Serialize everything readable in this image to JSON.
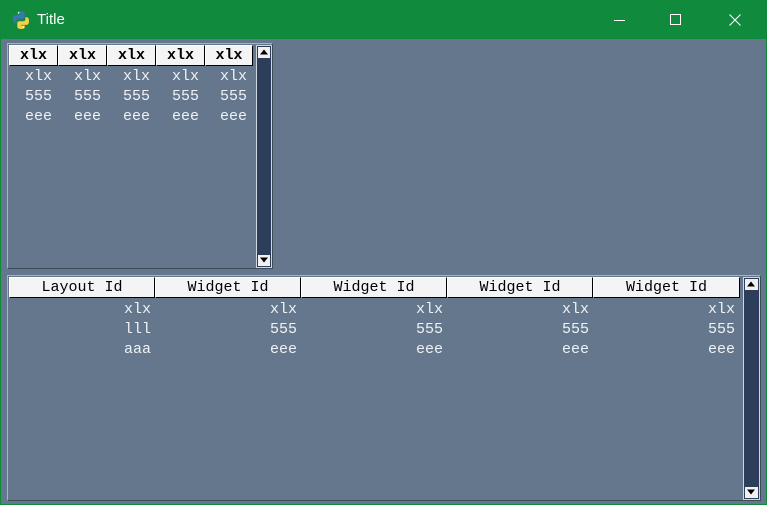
{
  "window": {
    "title": "Title",
    "colors": {
      "titlebar": "#108a3c",
      "background": "#64778d",
      "scrollbar": "#2c3e5a"
    }
  },
  "icons": {
    "app": "python-logo-icon",
    "minimize": "minimize-icon",
    "maximize": "maximize-icon",
    "close": "close-icon",
    "scroll_up": "arrow-up-icon",
    "scroll_down": "arrow-down-icon"
  },
  "table1": {
    "headers": [
      "xlx",
      "xlx",
      "xlx",
      "xlx",
      "xlx"
    ],
    "rows": [
      [
        "xlx",
        "xlx",
        "xlx",
        "xlx",
        "xlx"
      ],
      [
        "555",
        "555",
        "555",
        "555",
        "555"
      ],
      [
        "eee",
        "eee",
        "eee",
        "eee",
        "eee"
      ]
    ]
  },
  "table2": {
    "headers": [
      "Layout Id",
      "Widget Id",
      "Widget Id",
      "Widget Id",
      "Widget Id"
    ],
    "rows": [
      [
        "xlx",
        "xlx",
        "xlx",
        "xlx",
        "xlx"
      ],
      [
        "lll",
        "555",
        "555",
        "555",
        "555"
      ],
      [
        "aaa",
        "eee",
        "eee",
        "eee",
        "eee"
      ]
    ]
  }
}
